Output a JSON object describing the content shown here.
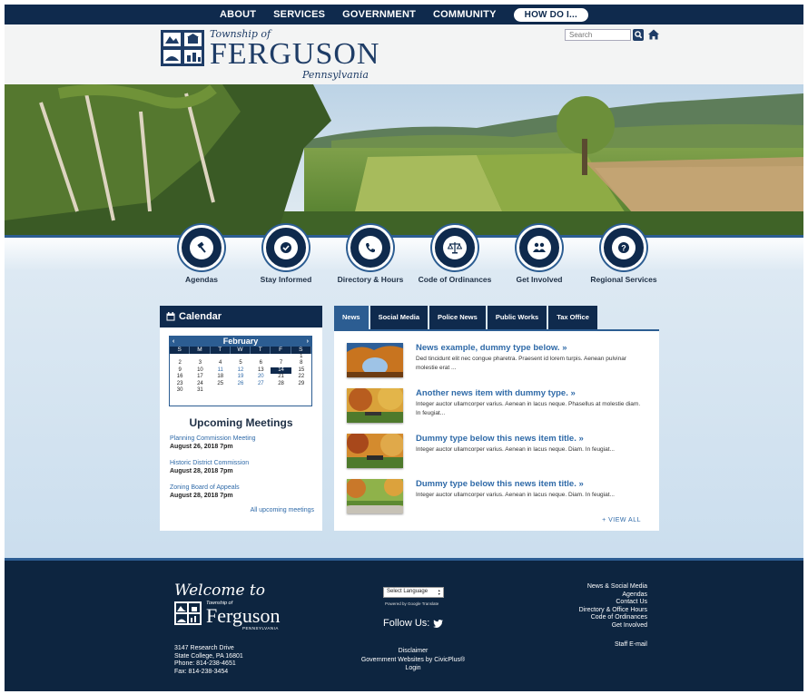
{
  "topnav": {
    "about": "ABOUT",
    "services": "SERVICES",
    "government": "GOVERNMENT",
    "community": "COMMUNITY",
    "howdoi": "HOW DO I..."
  },
  "header": {
    "township": "Township of",
    "name": "FERGUSON",
    "state": "Pennsylvania",
    "search_placeholder": "Search"
  },
  "quicklinks": [
    {
      "label": "Agendas",
      "icon": "gavel-icon"
    },
    {
      "label": "Stay Informed",
      "icon": "check-icon"
    },
    {
      "label": "Directory & Hours",
      "icon": "phone-icon"
    },
    {
      "label": "Code of Ordinances",
      "icon": "scales-icon"
    },
    {
      "label": "Get Involved",
      "icon": "people-icon"
    },
    {
      "label": "Regional Services",
      "icon": "question-icon"
    }
  ],
  "calendar": {
    "heading": "Calendar",
    "month": "February",
    "prev": "‹",
    "next": "›",
    "dow": [
      "S",
      "M",
      "T",
      "W",
      "T",
      "F",
      "S"
    ],
    "days": [
      "",
      "",
      "",
      "",
      "",
      "",
      "1",
      "2",
      "3",
      "4",
      "5",
      "6",
      "7",
      "8",
      "9",
      "10",
      "11",
      "12",
      "13",
      "14",
      "15",
      "16",
      "17",
      "18",
      "19",
      "20",
      "21",
      "22",
      "23",
      "24",
      "25",
      "26",
      "27",
      "28",
      "29",
      "30",
      "31",
      "",
      "",
      "",
      "",
      ""
    ],
    "event_days": [
      "11",
      "12",
      "19",
      "20",
      "26",
      "27"
    ],
    "today": "14"
  },
  "meetings": {
    "heading": "Upcoming Meetings",
    "items": [
      {
        "name": "Planning Commission Meeting",
        "date": "August 26, 2018 7pm"
      },
      {
        "name": "Historic District Commission",
        "date": "August 28, 2018 7pm"
      },
      {
        "name": "Zoning Board of Appeals",
        "date": "August 28, 2018 7pm"
      }
    ],
    "all_link": "All upcoming meetings"
  },
  "news": {
    "tabs": [
      "News",
      "Social Media",
      "Police News",
      "Public Works",
      "Tax Office"
    ],
    "items": [
      {
        "title": "News example, dummy type below.  »",
        "summary": "Ded tincidunt elit nec congue pharetra. Praesent id lorem turpis. Aenean pulvinar molestie erat ..."
      },
      {
        "title": "Another news item with dummy type.  »",
        "summary": "Integer auctor ullamcorper varius. Aenean in lacus neque. Phasellus at molestie diam. In feugiat..."
      },
      {
        "title": "Dummy type below this news item title.  »",
        "summary": "Integer auctor ullamcorper varius. Aenean in lacus neque. Diam. In feugiat..."
      },
      {
        "title": "Dummy type below this news item title.  »",
        "summary": "Integer auctor ullamcorper varius. Aenean in lacus neque. Diam. In feugiat..."
      }
    ],
    "view_all": "+ VIEW  ALL"
  },
  "footer": {
    "welcome": "Welcome to",
    "township": "Township of",
    "name": "Ferguson",
    "state": "PENNSYLVANIA",
    "address": [
      "3147 Research Drive",
      "State College, PA 16801",
      "Phone: 814-238-4651",
      "Fax: 814-238-3454"
    ],
    "language": "Select Language",
    "powered": "Powered by Google Translate",
    "follow": "Follow Us:",
    "mid_links": [
      "Disclaimer",
      "Government Websites by CivicPlus®",
      "Login"
    ],
    "right_links": [
      "News & Social Media",
      "Agendas",
      "Contact Us",
      "Directory & Office Hours",
      "Code of Ordinances",
      "Get Involved"
    ],
    "staff": "Staff E-mail"
  },
  "colors": {
    "navy": "#0f2a4d",
    "blue": "#2c5d92",
    "link": "#2f6aa8",
    "pale": "#cbdeee"
  }
}
